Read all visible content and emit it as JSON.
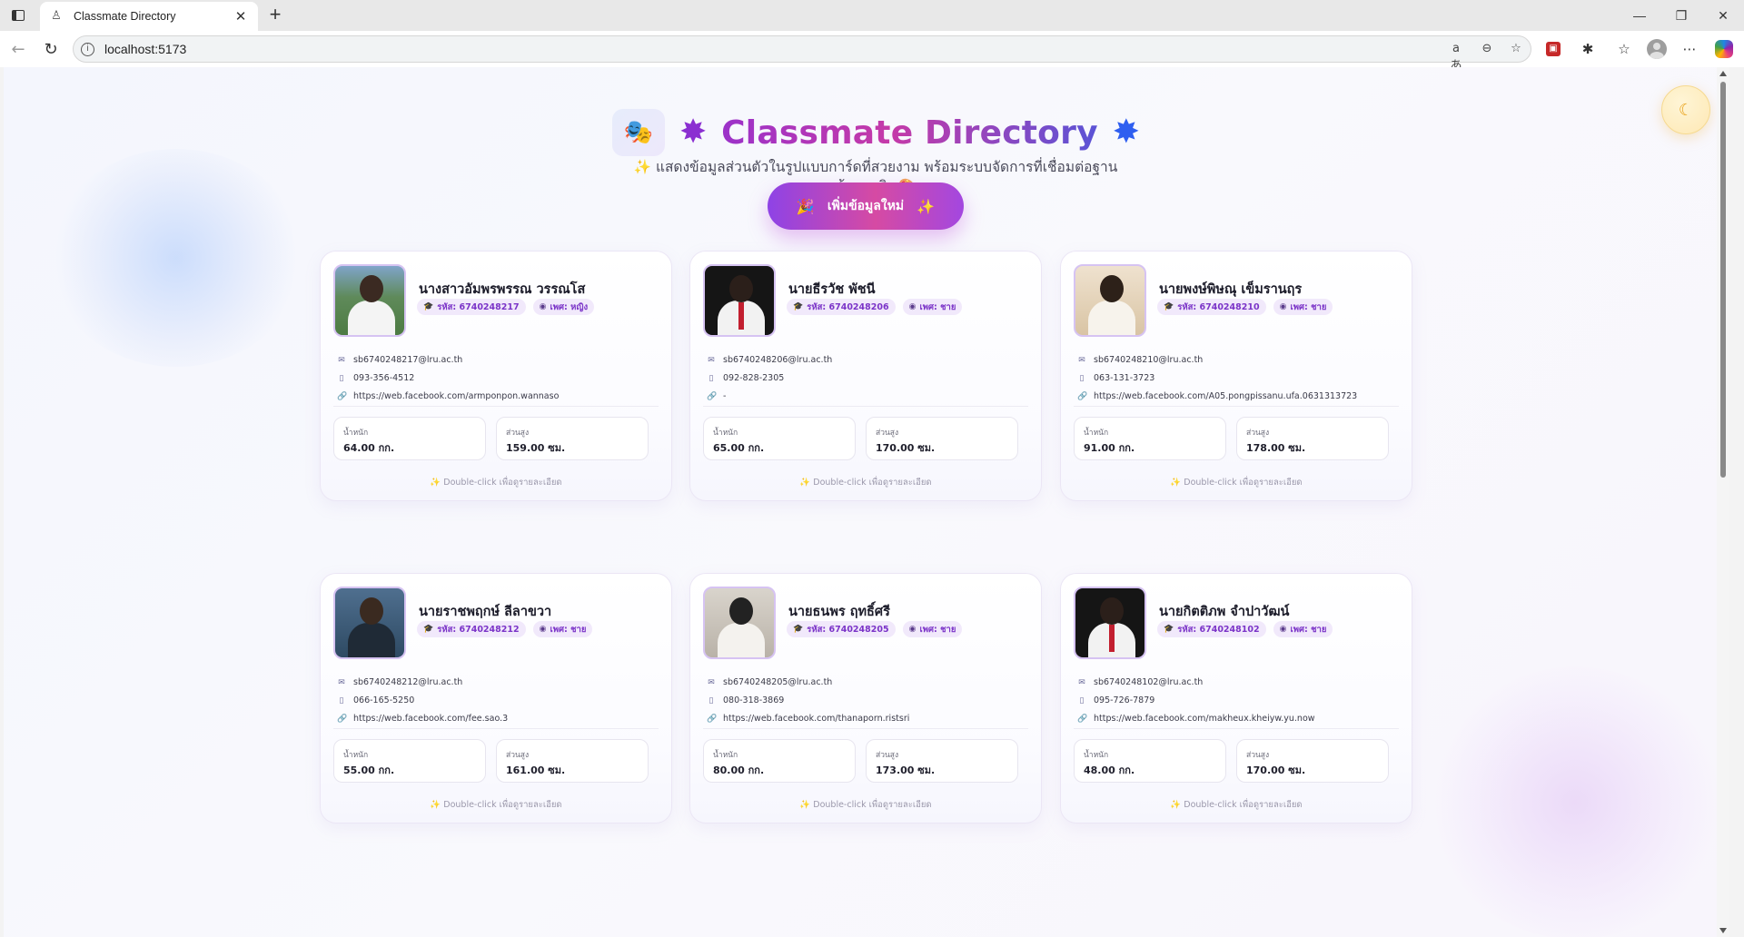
{
  "browser": {
    "tab_title": "Classmate Directory",
    "url": "localhost:5173",
    "new_tab": "+",
    "read_aloud": "aあ"
  },
  "app": {
    "title": "Classmate Directory",
    "subtitle_line1": "แสดงข้อมูลส่วนตัวในรูปแบบการ์ดที่สวยงาม พร้อมระบบจัดการที่เชื่อมต่อฐาน",
    "subtitle_line2": "ข้อมูลจริง",
    "add_button_label": "เพิ่มข้อมูลใหม่",
    "hint_text": "Double-click เพื่อดูรายละเอียด",
    "weight_label": "น้ำหนัก",
    "height_label": "ส่วนสูง"
  },
  "colors": {
    "accent_purple": "#8b2fd1",
    "accent_pink": "#d64aa3",
    "accent_blue": "#2f5ff0",
    "badge_bg": "#f1e9fb"
  },
  "students": [
    {
      "name": "นางสาวอัมพรพรรณ วรรณโส",
      "id_badge": "รหัส: 6740248217",
      "gender_badge": "เพศ: หญิง",
      "email": "sb6740248217@lru.ac.th",
      "phone": "093-356-4512",
      "facebook": "https://web.facebook.com/armponpon.wannaso",
      "weight": "64.00 กก.",
      "height": "159.00 ซม."
    },
    {
      "name": "นายธีรวัช พัชนี",
      "id_badge": "รหัส: 6740248206",
      "gender_badge": "เพศ: ชาย",
      "email": "sb6740248206@lru.ac.th",
      "phone": "092-828-2305",
      "facebook": "-",
      "weight": "65.00 กก.",
      "height": "170.00 ซม."
    },
    {
      "name": "นายพงษ์พิษณุ เข็มรานฤร",
      "id_badge": "รหัส: 6740248210",
      "gender_badge": "เพศ: ชาย",
      "email": "sb6740248210@lru.ac.th",
      "phone": "063-131-3723",
      "facebook": "https://web.facebook.com/A05.pongpissanu.ufa.0631313723",
      "weight": "91.00 กก.",
      "height": "178.00 ซม."
    },
    {
      "name": "นายราชพฤกษ์ ลีลาขวา",
      "id_badge": "รหัส: 6740248212",
      "gender_badge": "เพศ: ชาย",
      "email": "sb6740248212@lru.ac.th",
      "phone": "066-165-5250",
      "facebook": "https://web.facebook.com/fee.sao.3",
      "weight": "55.00 กก.",
      "height": "161.00 ซม."
    },
    {
      "name": "นายธนพร ฤทธิ์ศรี",
      "id_badge": "รหัส: 6740248205",
      "gender_badge": "เพศ: ชาย",
      "email": "sb6740248205@lru.ac.th",
      "phone": "080-318-3869",
      "facebook": "https://web.facebook.com/thanaporn.ristsri",
      "weight": "80.00 กก.",
      "height": "173.00 ซม."
    },
    {
      "name": "นายกิตติภพ จำปาวัฒน์",
      "id_badge": "รหัส: 6740248102",
      "gender_badge": "เพศ: ชาย",
      "email": "sb6740248102@lru.ac.th",
      "phone": "095-726-7879",
      "facebook": "https://web.facebook.com/makheux.kheiyw.yu.now",
      "weight": "48.00 กก.",
      "height": "170.00 ซม."
    }
  ]
}
